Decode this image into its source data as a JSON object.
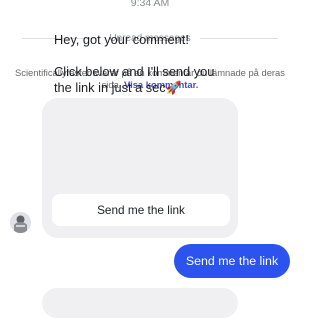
{
  "status_bar": {
    "time": "9:34 AM"
  },
  "divider": {
    "label": "Unread messages"
  },
  "notice": {
    "text": "Scientificallyfaster svarar på en kommentar du lämnade på deras sida.",
    "link_label": "Visa kommentar."
  },
  "bot_message": {
    "line1": "Hey, got your comment!",
    "line2": "Click below and I'll send you the link in just a sec",
    "emoji": "🚀",
    "button_label": "Send me the link"
  },
  "user_message": {
    "text": "Send me the link"
  },
  "colors": {
    "sent_bubble": "#2d53ee",
    "received_bubble": "#f0f0f3",
    "link": "#4b4bc8"
  }
}
